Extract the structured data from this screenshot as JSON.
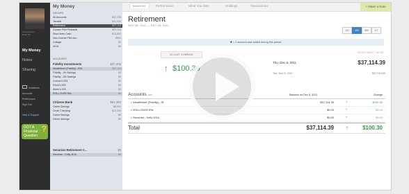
{
  "user": {
    "name_line1": "Lorem Ipsum",
    "name_line2": "Dolor Sit"
  },
  "nav": {
    "my_money": "My Money",
    "notes": "Notes",
    "sharing": "Sharing",
    "invitations": "Invitations",
    "accounts": "Accounts",
    "preferences": "Preferences",
    "sign_out": "Sign Out",
    "help": "Help & Support"
  },
  "promo": {
    "line1": "GOT A",
    "line2": "Financial",
    "line3": "Question",
    "mark": "?"
  },
  "accounts_panel": {
    "title": "My Money",
    "groups_label": "GROUPS",
    "groups": [
      {
        "label": "All Accounts",
        "value": "$92,335"
      },
      {
        "label": "Taxable",
        "value": "$41,204"
      },
      {
        "label": "Retirement",
        "value": "$37,114"
      },
      {
        "label": "Course Pilot Financial",
        "value": "$37,114"
      },
      {
        "label": "Short-term Cash",
        "value": "$13,832"
      },
      {
        "label": "Non-Course Pilot Acc...",
        "value": "$591"
      },
      {
        "label": "Collage",
        "value": "$0"
      },
      {
        "label": "401K",
        "value": "$0"
      }
    ],
    "accounts_label": "ACCOUNTS",
    "fidelity": {
      "label": "Fidelity Investments",
      "value": "$37,405"
    },
    "fidelity_items": [
      {
        "label": "Wealthfront (Fidelity) - IRA",
        "value": "$37,114"
      },
      {
        "label": "Fidelity - JH Savings",
        "value": "$0"
      },
      {
        "label": "Fidelity - JM Savings",
        "value": "$0"
      },
      {
        "label": "Connor's 529",
        "value": "$0"
      },
      {
        "label": "Finne's 529",
        "value": "$0"
      },
      {
        "label": "Aiden's 529",
        "value": "$0"
      },
      {
        "label": "ROLLOVER IRA",
        "value": "$0"
      }
    ],
    "citizens": {
      "label": "Citizens Bank",
      "value": "$54,384"
    },
    "citizens_items": [
      {
        "label": "Green Savings",
        "value": "$6,000"
      },
      {
        "label": "Circle Checking",
        "value": "$13,000"
      },
      {
        "label": "Green Savings",
        "value": "$0"
      },
      {
        "label": "Green Savings",
        "value": "$0"
      }
    ],
    "securian": {
      "label": "Securian Retirement C...",
      "value": "$0"
    },
    "securian_items": [
      {
        "label": "Securian - Kelly 401k",
        "value": "$0"
      }
    ]
  },
  "tabs": [
    "Balances",
    "Performance",
    "What You Own",
    "Holdings",
    "Transactions"
  ],
  "make_note": "Make a Note",
  "page": {
    "title": "Retirement",
    "date_range": "NOV 08, 2011 — DEC 08, 2011",
    "ranges": [
      "1D",
      "1M",
      "6M",
      "1Y"
    ],
    "banner": "= 1 account was added during this period.",
    "change_label": "30-DAY CHANGE",
    "change_value": "$100.30",
    "investment_label": "INVESTMENT VALUE",
    "date1": "Thu, Dec 8, 2011",
    "value1": "$37,114.39",
    "date2": "Tue, Nov 8, 2011",
    "value2": "$37,014.09"
  },
  "table": {
    "head_accounts": "Accounts",
    "head_hide": "hide",
    "head_balance": "Balance on Dec 8, 2011",
    "head_change": "Change",
    "rows": [
      {
        "name": "Wealthfront (Fidelity) - IR",
        "balance": "$37,114.39",
        "change": "$100.30"
      },
      {
        "name": "ROLLOVER IRA",
        "balance": "$0.00",
        "change": "$0.00"
      },
      {
        "name": "Securian - Kelly 401k",
        "balance": "$0.00",
        "change": "$0.00"
      }
    ],
    "total_label": "Total",
    "total_balance": "$37,114.39",
    "total_change": "$100.30"
  },
  "colors": {
    "accent_blue": "#3d86c6",
    "positive_green": "#2f9a4e",
    "promo_green": "#7fb13a"
  }
}
